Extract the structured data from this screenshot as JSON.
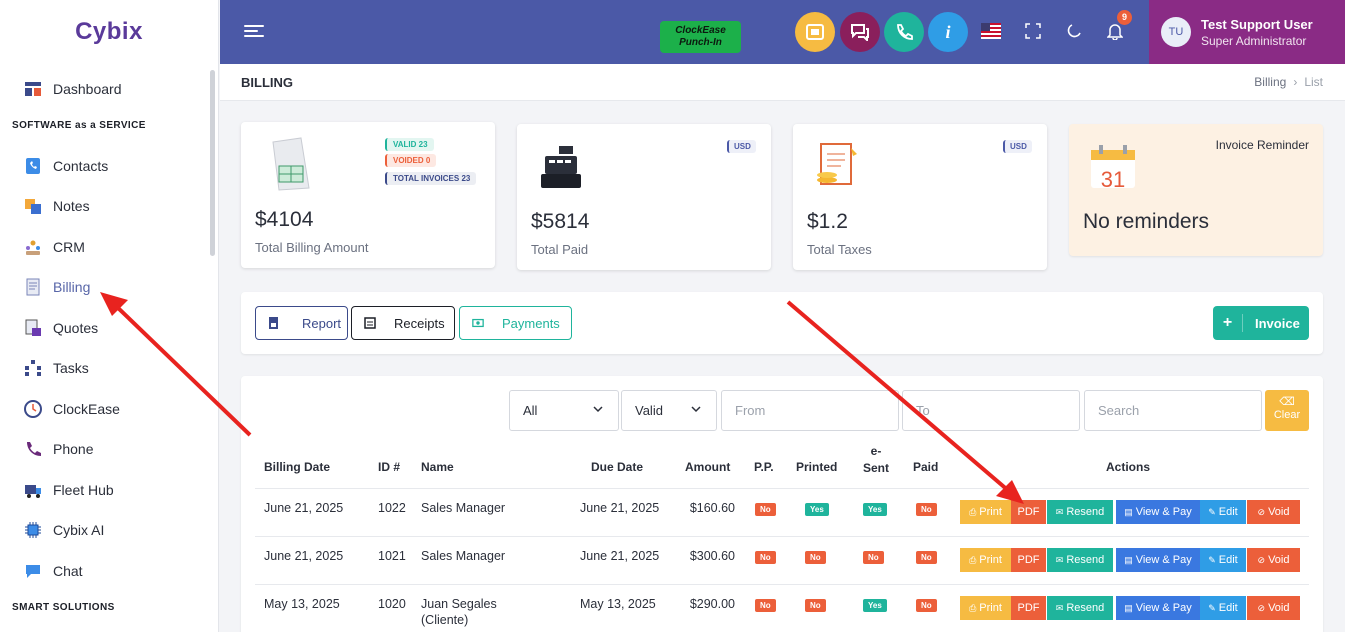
{
  "app": {
    "logo": "Cybix"
  },
  "sidebar": {
    "items": [
      {
        "label": "Dashboard",
        "icon": "dashboard-icon"
      },
      {
        "label": "Contacts",
        "icon": "contacts-icon"
      },
      {
        "label": "Notes",
        "icon": "notes-icon"
      },
      {
        "label": "CRM",
        "icon": "crm-icon"
      },
      {
        "label": "Billing",
        "icon": "billing-icon"
      },
      {
        "label": "Quotes",
        "icon": "quotes-icon"
      },
      {
        "label": "Tasks",
        "icon": "tasks-icon"
      },
      {
        "label": "ClockEase",
        "icon": "clock-icon"
      },
      {
        "label": "Phone",
        "icon": "phone-icon"
      },
      {
        "label": "Fleet Hub",
        "icon": "truck-icon"
      },
      {
        "label": "Cybix AI",
        "icon": "ai-chip-icon"
      },
      {
        "label": "Chat",
        "icon": "chat-icon"
      }
    ],
    "sections": [
      "SOFTWARE as a SERVICE",
      "SMART SOLUTIONS"
    ]
  },
  "topbar": {
    "punch_line1": "ClockEase",
    "punch_line2": "Punch-In",
    "notification_count": "9",
    "user_initials": "TU",
    "user_name": "Test Support User",
    "user_role": "Super Administrator",
    "colors": {
      "bar": "#4b59a7",
      "user": "#8a2b85"
    }
  },
  "page": {
    "title": "BILLING",
    "breadcrumb": [
      "Billing",
      "List"
    ]
  },
  "stats": {
    "billing": {
      "amount": "$4104",
      "label": "Total Billing Amount",
      "valid": "VALID 23",
      "voided": "VOIDED 0",
      "total": "TOTAL INVOICES 23"
    },
    "paid": {
      "amount": "$5814",
      "label": "Total Paid",
      "currency": "USD"
    },
    "taxes": {
      "amount": "$1.2",
      "label": "Total Taxes",
      "currency": "USD"
    },
    "reminder": {
      "title": "Invoice Reminder",
      "calendar_day": "31",
      "message": "No reminders"
    }
  },
  "actions": {
    "report": "Report",
    "receipts": "Receipts",
    "payments": "Payments",
    "invoice": "Invoice",
    "invoice_plus": "+"
  },
  "filters": {
    "status": "All",
    "validity": "Valid",
    "from_placeholder": "From",
    "to_placeholder": "To",
    "search_placeholder": "Search",
    "clear": "Clear"
  },
  "table": {
    "headers": {
      "billing_date": "Billing Date",
      "id": "ID #",
      "name": "Name",
      "due_date": "Due Date",
      "amount": "Amount",
      "pp": "P.P.",
      "printed": "Printed",
      "esent1": "e-",
      "esent2": "Sent",
      "paid": "Paid",
      "actions": "Actions"
    },
    "buttons": {
      "print": "Print",
      "pdf": "PDF",
      "resend": "Resend",
      "view_pay": "View & Pay",
      "edit": "Edit",
      "void": "Void"
    },
    "rows": [
      {
        "billing_date": "June 21, 2025",
        "id": "1022",
        "name": "Sales Manager",
        "name2": "",
        "due_date": "June 21, 2025",
        "amount": "$160.60",
        "pp": "No",
        "printed": "Yes",
        "esent": "Yes",
        "paid": "No"
      },
      {
        "billing_date": "June 21, 2025",
        "id": "1021",
        "name": "Sales Manager",
        "name2": "",
        "due_date": "June 21, 2025",
        "amount": "$300.60",
        "pp": "No",
        "printed": "No",
        "esent": "No",
        "paid": "No"
      },
      {
        "billing_date": "May 13, 2025",
        "id": "1020",
        "name": "Juan Segales",
        "name2": "(Cliente)",
        "due_date": "May 13, 2025",
        "amount": "$290.00",
        "pp": "No",
        "printed": "No",
        "esent": "Yes",
        "paid": "No"
      }
    ]
  }
}
